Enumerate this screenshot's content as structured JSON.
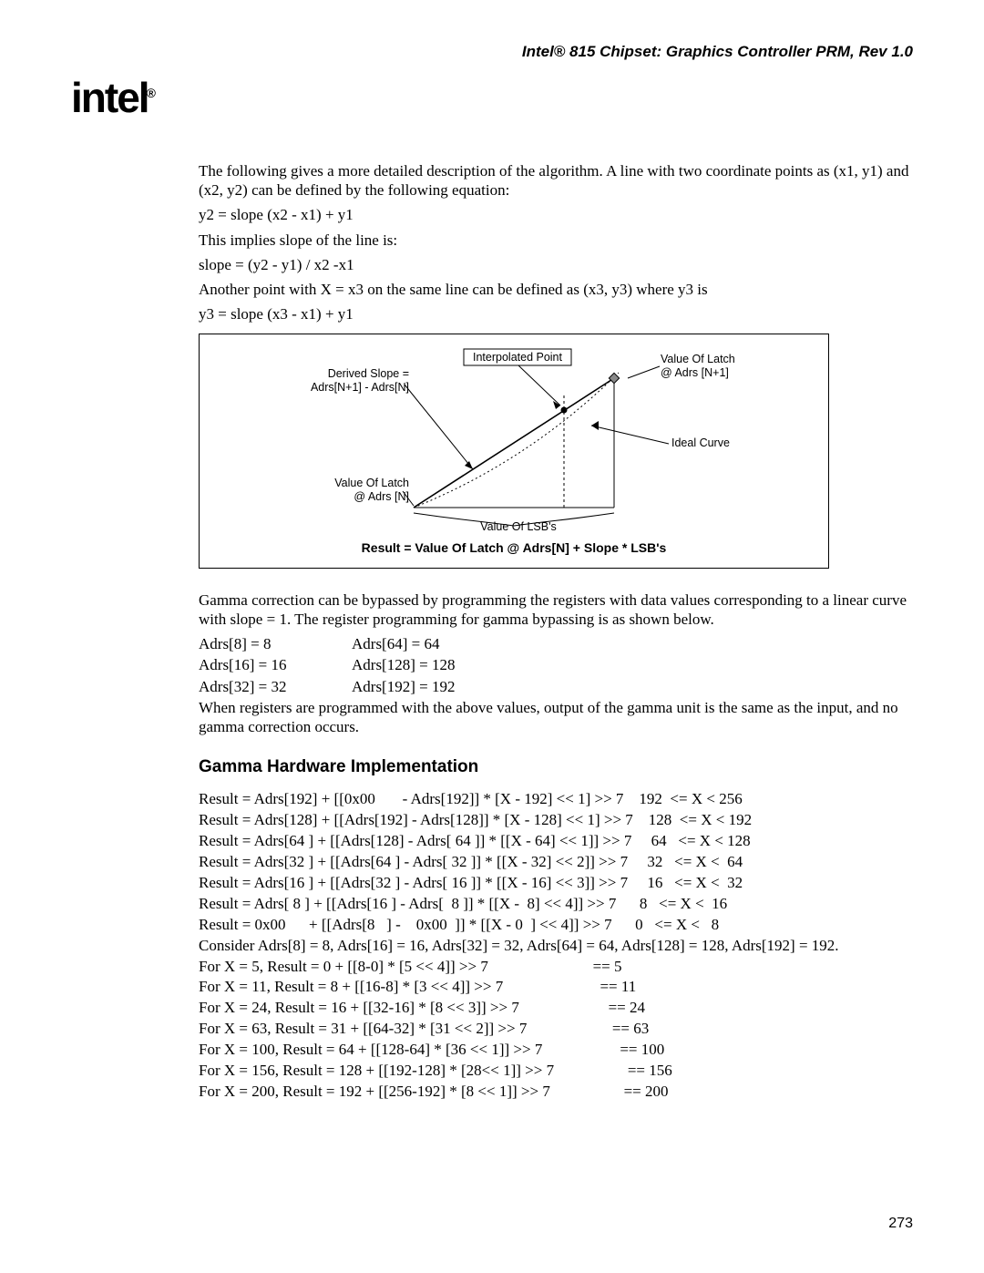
{
  "header": "Intel® 815 Chipset: Graphics Controller PRM, Rev 1.0",
  "logo": "intel",
  "intro1": "The following gives a more detailed description of the algorithm. A line with two coordinate points as (x1, y1) and (x2, y2) can be defined by the following equation:",
  "eq1": "y2 = slope (x2 - x1) + y1",
  "intro2": "This implies slope of the line is:",
  "eq2": "slope = (y2 - y1) / x2 -x1",
  "intro3": "Another point with X = x3 on the same line can be defined as (x3, y3) where y3 is",
  "eq3": "y3 = slope (x3 - x1) + y1",
  "figure": {
    "derived_slope_l1": "Derived Slope =",
    "derived_slope_l2": "Adrs[N+1] - Adrs[N]",
    "interp": "Interpolated Point",
    "value_np1_l1": "Value Of Latch",
    "value_np1_l2": "@ Adrs [N+1]",
    "ideal": "Ideal Curve",
    "value_n_l1": "Value Of Latch",
    "value_n_l2": "@ Adrs [N]",
    "lsb": "Value Of LSB's",
    "caption": "Result = Value Of Latch @ Adrs[N] + Slope * LSB's"
  },
  "post_fig": "Gamma correction can be bypassed by programming the registers with data values corresponding to a linear curve with slope = 1. The register programming for gamma bypassing is as shown below.",
  "adrs": [
    [
      "Adrs[8] = 8",
      "Adrs[64] = 64"
    ],
    [
      "Adrs[16] = 16",
      "Adrs[128] = 128"
    ],
    [
      "Adrs[32] = 32",
      "Adrs[192] = 192"
    ]
  ],
  "adrs_note": "When registers are programmed with the above values, output of the gamma unit is the same as the input, and no gamma correction occurs.",
  "section_h": "Gamma Hardware Implementation",
  "impl_block": "Result = Adrs[192] + [[0x00       - Adrs[192]] * [X - 192] << 1] >> 7    192  <= X < 256\nResult = Adrs[128] + [[Adrs[192] - Adrs[128]] * [X - 128] << 1] >> 7    128  <= X < 192\nResult = Adrs[64 ] + [[Adrs[128] - Adrs[ 64 ]] * [[X - 64] << 1]] >> 7     64   <= X < 128\nResult = Adrs[32 ] + [[Adrs[64 ] - Adrs[ 32 ]] * [[X - 32] << 2]] >> 7     32   <= X <  64\nResult = Adrs[16 ] + [[Adrs[32 ] - Adrs[ 16 ]] * [[X - 16] << 3]] >> 7     16   <= X <  32\nResult = Adrs[ 8 ] + [[Adrs[16 ] - Adrs[  8 ]] * [[X -  8] << 4]] >> 7      8   <= X <  16\nResult = 0x00      + [[Adrs[8   ] -    0x00  ]] * [[X - 0  ] << 4]] >> 7      0   <= X <   8",
  "example_block": "Consider Adrs[8] = 8, Adrs[16] = 16, Adrs[32] = 32, Adrs[64] = 64, Adrs[128] = 128, Adrs[192] = 192.\nFor X = 5, Result = 0 + [[8-0] * [5 << 4]] >> 7                           == 5\nFor X = 11, Result = 8 + [[16-8] * [3 << 4]] >> 7                         == 11\nFor X = 24, Result = 16 + [[32-16] * [8 << 3]] >> 7                       == 24\nFor X = 63, Result = 31 + [[64-32] * [31 << 2]] >> 7                      == 63\nFor X = 100, Result = 64 + [[128-64] * [36 << 1]] >> 7                    == 100\nFor X = 156, Result = 128 + [[192-128] * [28<< 1]] >> 7                   == 156\nFor X = 200, Result = 192 + [[256-192] * [8 << 1]] >> 7                   == 200",
  "page_num": "273"
}
